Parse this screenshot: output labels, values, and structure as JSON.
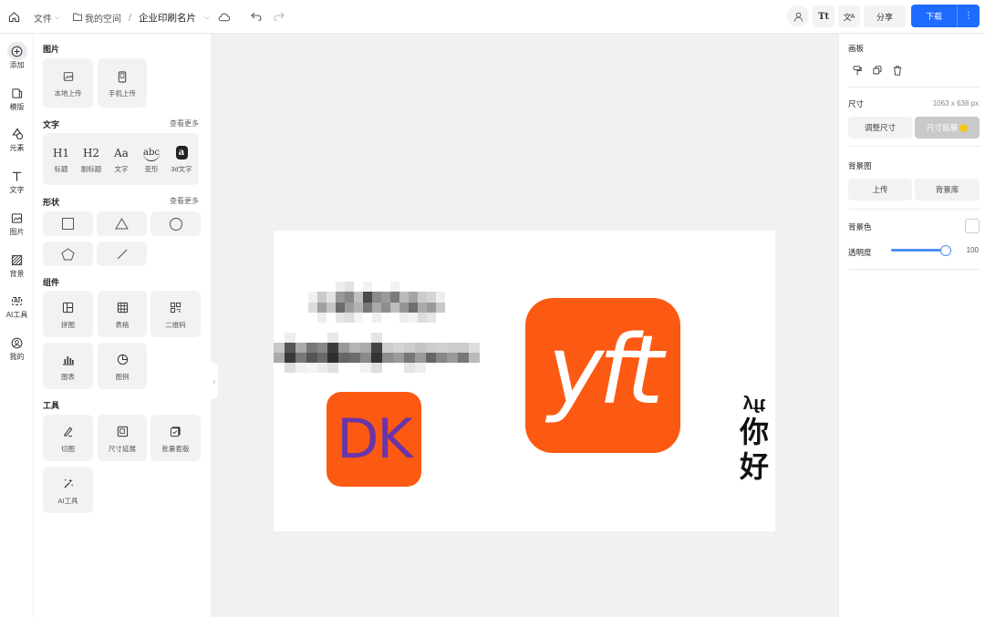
{
  "topbar": {
    "file_menu": "文件",
    "breadcrumb_space": "我的空间",
    "breadcrumb_sep": "/",
    "doc_title": "企业印刷名片",
    "share_label": "分享",
    "download_label": "下载"
  },
  "rail": {
    "items": [
      {
        "label": "添加",
        "icon": "add-circle-icon"
      },
      {
        "label": "模版",
        "icon": "template-icon"
      },
      {
        "label": "元素",
        "icon": "elements-icon"
      },
      {
        "label": "文字",
        "icon": "text-icon"
      },
      {
        "label": "图片",
        "icon": "image-icon"
      },
      {
        "label": "背景",
        "icon": "background-icon"
      },
      {
        "label": "AI工具",
        "icon": "ai-icon"
      },
      {
        "label": "我的",
        "icon": "user-icon"
      }
    ]
  },
  "panel": {
    "image_section": "图片",
    "image_tiles": [
      {
        "label": "本地上传",
        "icon": "local-upload-icon"
      },
      {
        "label": "手机上传",
        "icon": "phone-upload-icon"
      }
    ],
    "text_section": "文字",
    "text_more": "查看更多",
    "text_tiles": [
      {
        "glyph": "H1",
        "label": "标题"
      },
      {
        "glyph": "H2",
        "label": "副标题"
      },
      {
        "glyph": "Aa",
        "label": "文字"
      },
      {
        "glyph": "abc",
        "label": "变形"
      },
      {
        "glyph": "a",
        "label": "3d文字"
      }
    ],
    "shape_section": "形状",
    "shape_more": "查看更多",
    "component_section": "组件",
    "component_tiles": [
      {
        "label": "拼图",
        "icon": "collage-icon"
      },
      {
        "label": "表格",
        "icon": "table-icon"
      },
      {
        "label": "二维码",
        "icon": "qrcode-icon"
      },
      {
        "label": "图表",
        "icon": "chart-icon"
      },
      {
        "label": "图例",
        "icon": "pie-icon"
      }
    ],
    "tool_section": "工具",
    "tool_tiles": [
      {
        "label": "切图",
        "icon": "slice-icon"
      },
      {
        "label": "尺寸延展",
        "icon": "resize-icon"
      },
      {
        "label": "批量套版",
        "icon": "batch-icon"
      },
      {
        "label": "AI工具",
        "icon": "ai-tool-icon"
      }
    ]
  },
  "canvas": {
    "logo_small_text": "DK",
    "logo_large_text": "yft",
    "vertical_rotated": "yft",
    "vertical_cn_1": "你",
    "vertical_cn_2": "好",
    "accent": "#fc5a12",
    "dk_text_color": "#6a35a8"
  },
  "rpanel": {
    "canvas_title": "画板",
    "size_label": "尺寸",
    "size_value": "1063 x 638 px",
    "resize_button": "调整尺寸",
    "extend_button": "尺寸延展",
    "bgimage_label": "背景图",
    "upload_button": "上传",
    "library_button": "背景库",
    "bgcolor_label": "背景色",
    "opacity_label": "透明度",
    "opacity_value": "100",
    "opacity_fraction": 1.0
  },
  "colors": {
    "primary": "#1e6bff",
    "workspace_bg": "#f1f1f2"
  }
}
